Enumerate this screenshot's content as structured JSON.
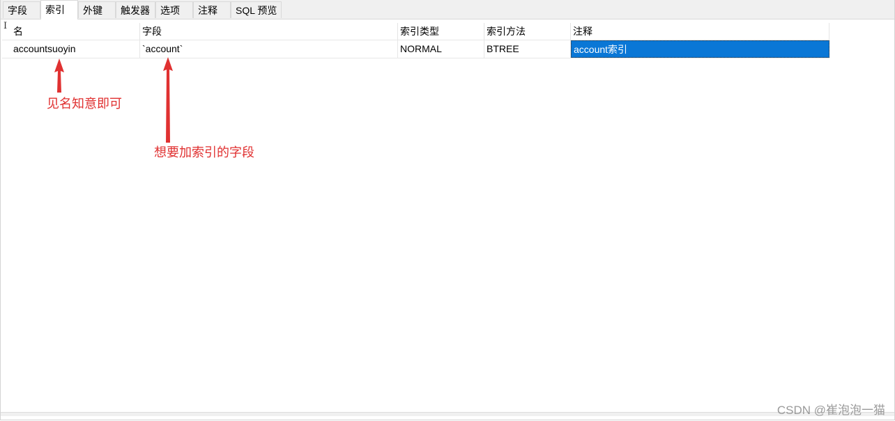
{
  "tabs": [
    {
      "label": "字段",
      "active": false
    },
    {
      "label": "索引",
      "active": true
    },
    {
      "label": "外键",
      "active": false
    },
    {
      "label": "触发器",
      "active": false
    },
    {
      "label": "选项",
      "active": false
    },
    {
      "label": "注释",
      "active": false
    },
    {
      "label": "SQL 预览",
      "active": false
    }
  ],
  "index_table": {
    "columns": [
      "名",
      "字段",
      "索引类型",
      "索引方法",
      "注释"
    ],
    "rows": [
      {
        "name": "accountsuoyin",
        "field": "`account`",
        "index_type": "NORMAL",
        "index_method": "BTREE",
        "comment": "account索引"
      }
    ]
  },
  "annotations": {
    "name_hint": "见名知意即可",
    "field_hint": "想要加索引的字段",
    "color": "#e03131"
  },
  "watermark": "CSDN @崔泡泡一猫",
  "colors": {
    "selection": "#0a77d6",
    "tab_bg": "#f0f0f0"
  }
}
